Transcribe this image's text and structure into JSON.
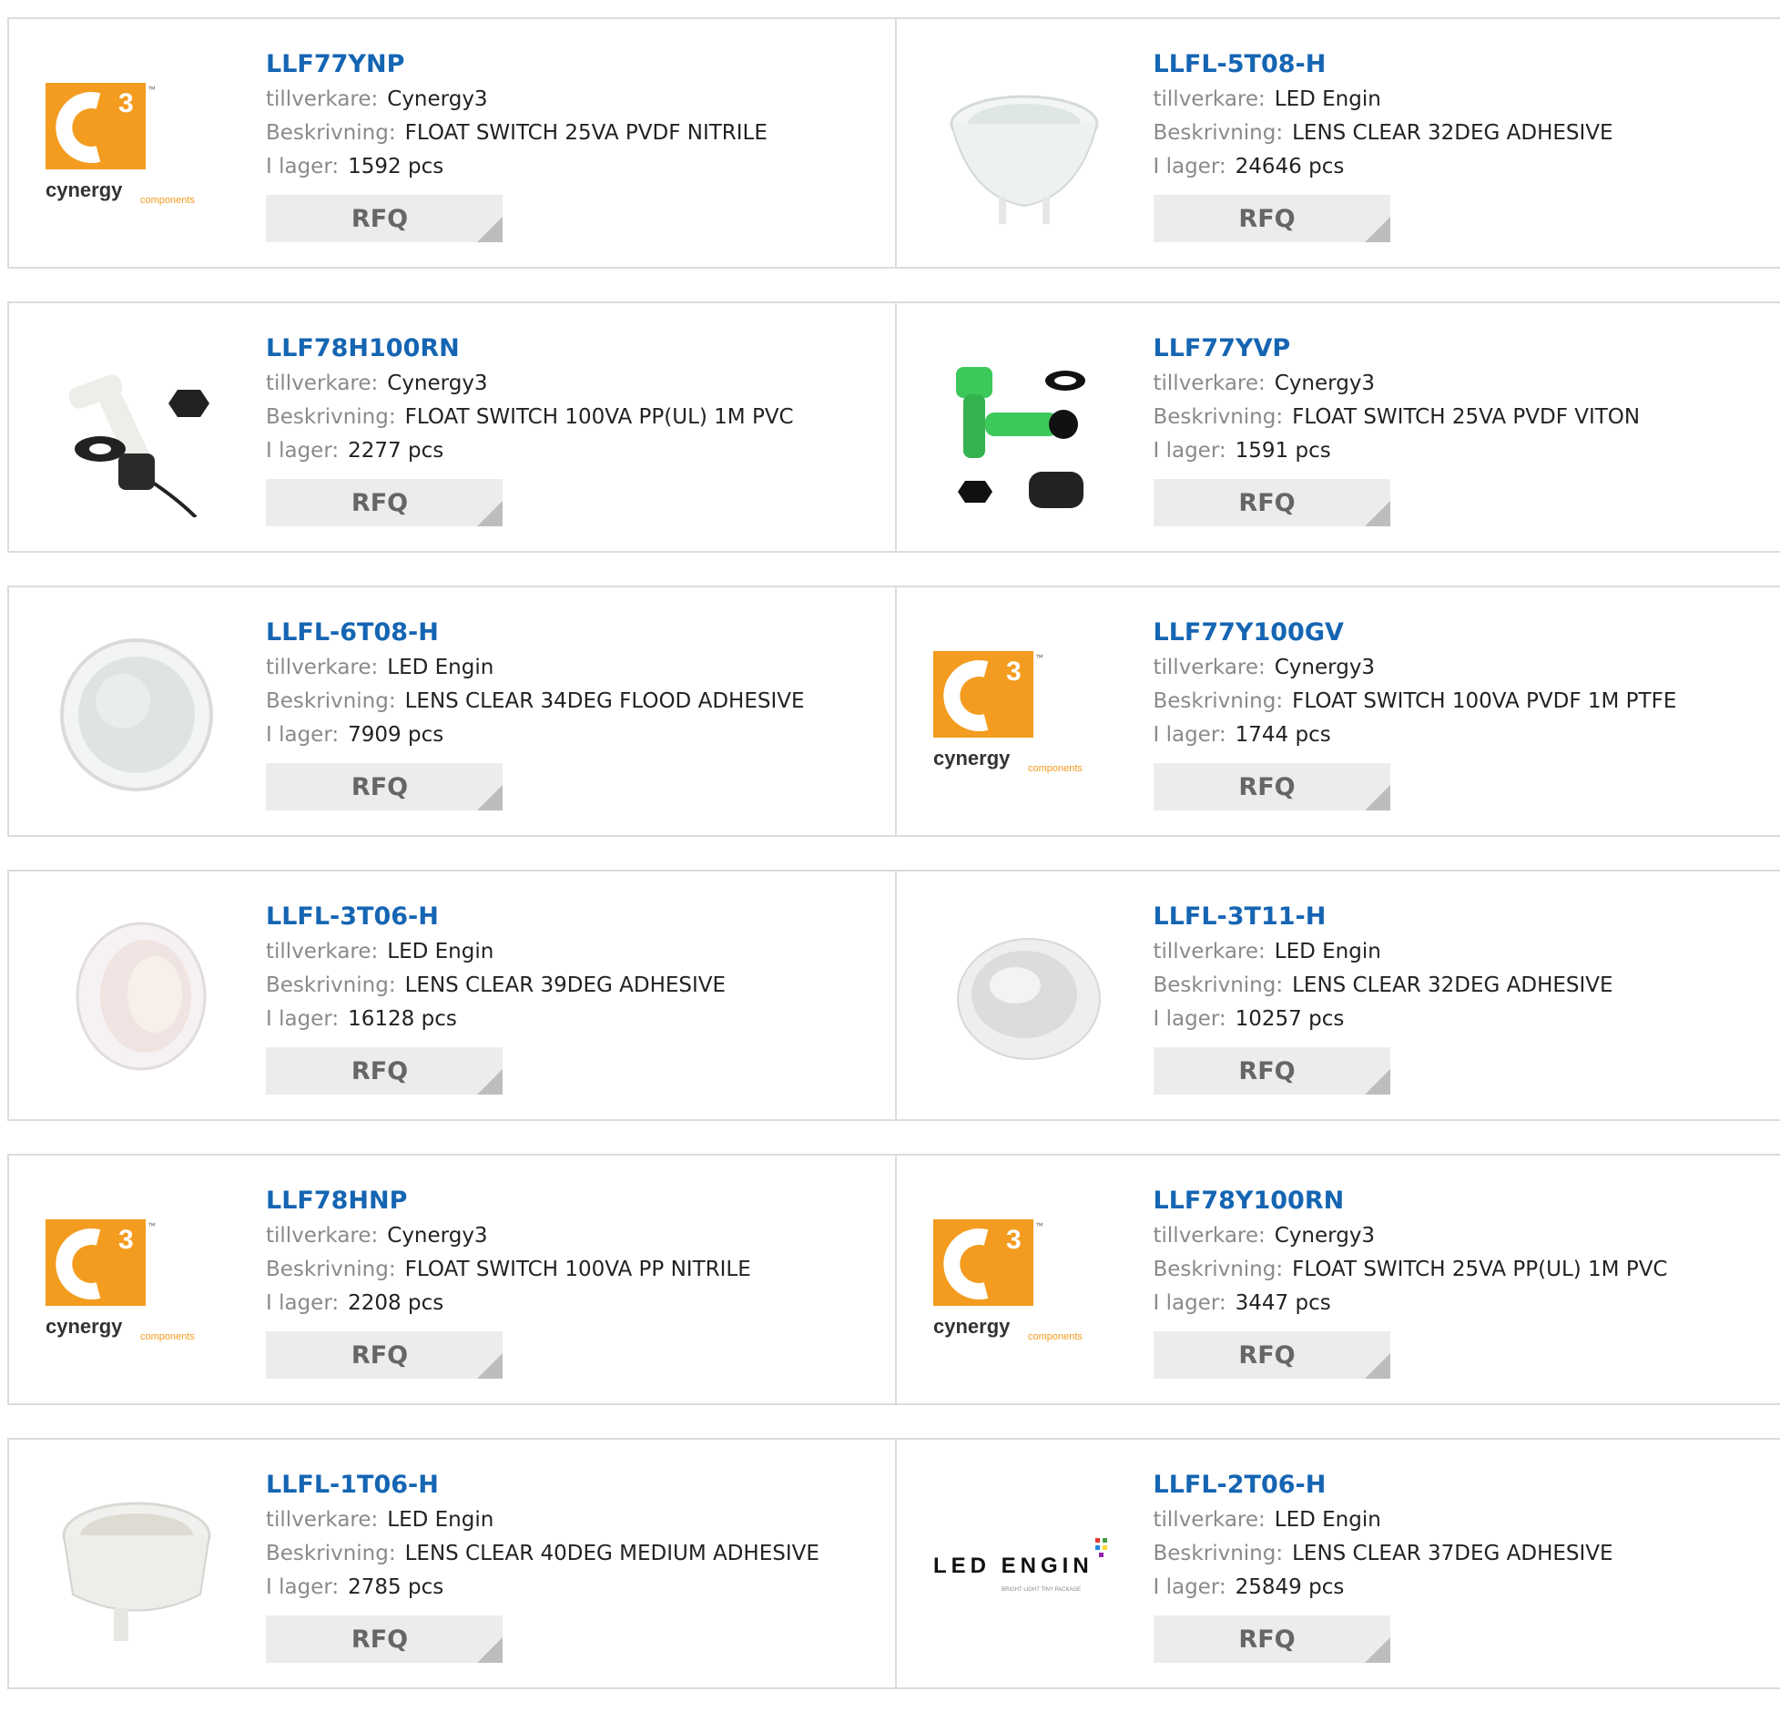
{
  "labels": {
    "mfr": "tillverkare:",
    "desc": "Beskrivning:",
    "stock": "I lager:"
  },
  "rfq_label": "RFQ",
  "logos": {
    "cynergy_main": "cynergy",
    "cynergy_sub": "components",
    "cynergy_digit": "3",
    "cynergy_tm": "™",
    "ledengin_text": "LED ENGIN",
    "ledengin_tagline": "BRIGHT LIGHT TINY PACKAGE"
  },
  "colors": {
    "partnumber": "#1565b3",
    "cynergy_orange": "#f39c1f",
    "rfq_bg": "#ececec"
  },
  "products": [
    {
      "pn": "LLF77YNP",
      "mfr": "Cynergy3",
      "desc": "FLOAT SWITCH 25VA PVDF NITRILE",
      "stock": "1592 pcs",
      "image": "cynergy-logo"
    },
    {
      "pn": "LLFL-5T08-H",
      "mfr": "LED Engin",
      "desc": "LENS CLEAR 32DEG ADHESIVE",
      "stock": "24646 pcs",
      "image": "lens-legs"
    },
    {
      "pn": "LLF78H100RN",
      "mfr": "Cynergy3",
      "desc": "FLOAT SWITCH 100VA PP(UL) 1M PVC",
      "stock": "2277 pcs",
      "image": "float-switch-white"
    },
    {
      "pn": "LLF77YVP",
      "mfr": "Cynergy3",
      "desc": "FLOAT SWITCH 25VA PVDF VITON",
      "stock": "1591 pcs",
      "image": "float-switch-green"
    },
    {
      "pn": "LLFL-6T08-H",
      "mfr": "LED Engin",
      "desc": "LENS CLEAR 34DEG FLOOD ADHESIVE",
      "stock": "7909 pcs",
      "image": "lens-round"
    },
    {
      "pn": "LLF77Y100GV",
      "mfr": "Cynergy3",
      "desc": "FLOAT SWITCH 100VA PVDF 1M PTFE",
      "stock": "1744 pcs",
      "image": "cynergy-logo"
    },
    {
      "pn": "LLFL-3T06-H",
      "mfr": "LED Engin",
      "desc": "LENS CLEAR 39DEG ADHESIVE",
      "stock": "16128 pcs",
      "image": "lens-tilted"
    },
    {
      "pn": "LLFL-3T11-H",
      "mfr": "LED Engin",
      "desc": "LENS CLEAR 32DEG ADHESIVE",
      "stock": "10257 pcs",
      "image": "lens-dish"
    },
    {
      "pn": "LLF78HNP",
      "mfr": "Cynergy3",
      "desc": "FLOAT SWITCH 100VA PP NITRILE",
      "stock": "2208 pcs",
      "image": "cynergy-logo"
    },
    {
      "pn": "LLF78Y100RN",
      "mfr": "Cynergy3",
      "desc": "FLOAT SWITCH 25VA PP(UL) 1M PVC",
      "stock": "3447 pcs",
      "image": "cynergy-logo"
    },
    {
      "pn": "LLFL-1T06-H",
      "mfr": "LED Engin",
      "desc": "LENS CLEAR 40DEG MEDIUM ADHESIVE",
      "stock": "2785 pcs",
      "image": "lens-holder"
    },
    {
      "pn": "LLFL-2T06-H",
      "mfr": "LED Engin",
      "desc": "LENS CLEAR 37DEG ADHESIVE",
      "stock": "25849 pcs",
      "image": "ledengin-logo"
    }
  ]
}
